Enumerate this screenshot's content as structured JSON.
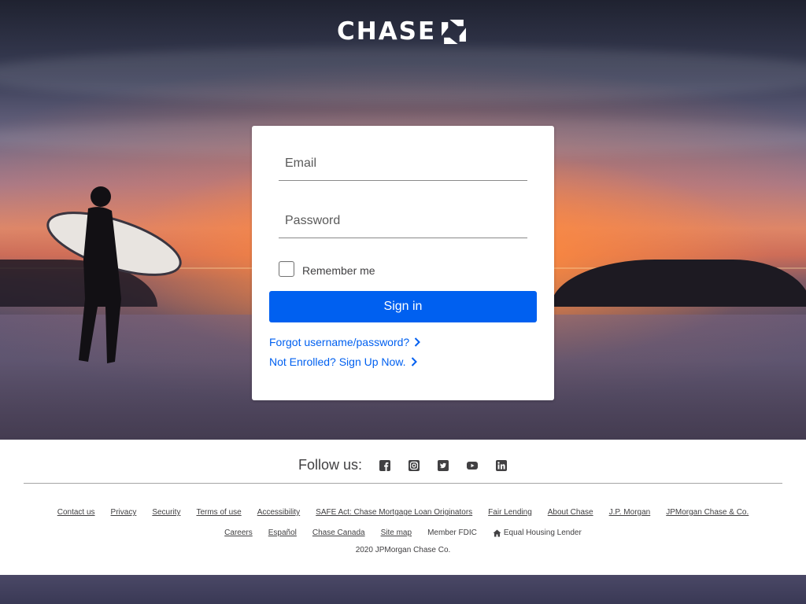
{
  "brand": {
    "name": "CHASE"
  },
  "login": {
    "email_placeholder": "Email",
    "password_placeholder": "Password",
    "remember_label": "Remember me",
    "signin_label": "Sign in",
    "forgot_link": "Forgot username/password?",
    "enroll_link": "Not Enrolled? Sign Up Now."
  },
  "footer": {
    "follow_label": "Follow us:",
    "social_icons": [
      "facebook-icon",
      "instagram-icon",
      "twitter-icon",
      "youtube-icon",
      "linkedin-icon"
    ],
    "links_row1": [
      "Contact us",
      "Privacy",
      "Security",
      "Terms of use",
      "Accessibility",
      "SAFE Act: Chase Mortgage Loan Originators",
      "Fair Lending",
      "About Chase",
      "J.P. Morgan",
      "JPMorgan Chase & Co."
    ],
    "links_row2": [
      "Careers",
      "Español",
      "Chase Canada",
      "Site map"
    ],
    "member_fdic": "Member FDIC",
    "equal_housing": "Equal Housing Lender",
    "copyright": "2020 JPMorgan Chase Co."
  },
  "colors": {
    "primary": "#0060f0",
    "text": "#414042"
  }
}
